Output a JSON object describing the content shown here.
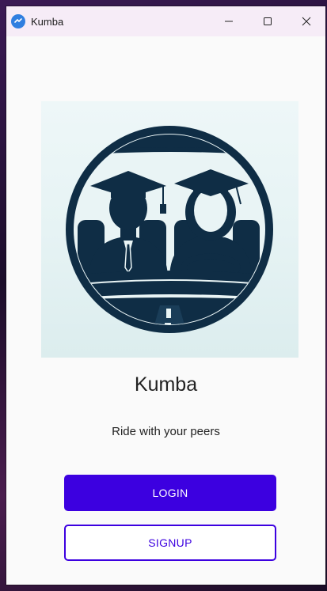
{
  "window": {
    "title": "Kumba",
    "controls": {
      "minimize_icon": "minimize-icon",
      "maximize_icon": "maximize-icon",
      "close_icon": "close-icon"
    }
  },
  "main": {
    "hero_image": "students-driving-illustration",
    "app_name": "Kumba",
    "tagline": "Ride with your peers",
    "login_label": "LOGIN",
    "signup_label": "SIGNUP"
  },
  "colors": {
    "primary": "#3c00e0",
    "titlebar": "#f6ecf7",
    "illustration_navy": "#0f2d45",
    "hero_background": "#e6f3f4"
  }
}
